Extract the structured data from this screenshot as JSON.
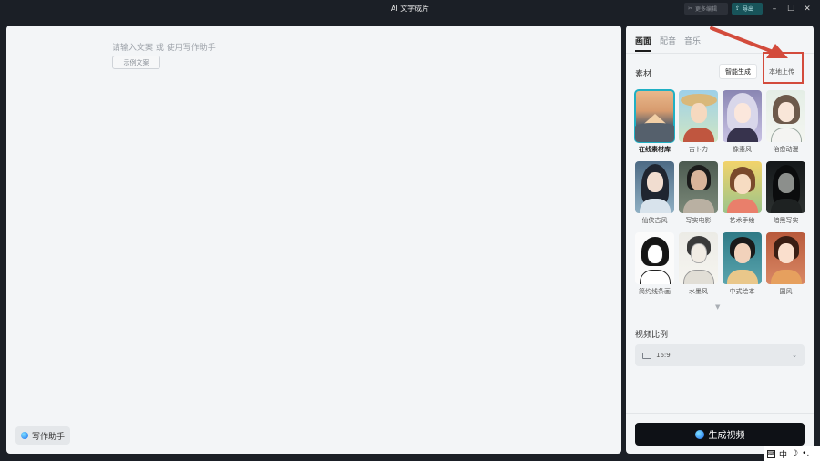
{
  "window": {
    "title": "AI 文字成片",
    "more_edit_label": "更多编辑",
    "export_label": "导出",
    "controls": [
      "minimize-icon",
      "maximize-icon",
      "close-icon"
    ]
  },
  "editor": {
    "placeholder": "请输入文案 或 使用写作助手",
    "example_button": "示例文案",
    "assistant_button": "写作助手"
  },
  "panel": {
    "tabs": [
      {
        "label": "画面",
        "active": true
      },
      {
        "label": "配音",
        "active": false
      },
      {
        "label": "音乐",
        "active": false
      }
    ],
    "material_label": "素材",
    "mode_smart": "智能生成",
    "mode_local": "本地上传",
    "styles": [
      {
        "label": "在线素材库",
        "selected": true,
        "icon": "mountain-landscape"
      },
      {
        "label": "吉卜力",
        "selected": false,
        "icon": "anime-girl-straw-hat"
      },
      {
        "label": "像素风",
        "selected": false,
        "icon": "anime-girl-silver-hair"
      },
      {
        "label": "治愈动漫",
        "selected": false,
        "icon": "sketch-girl"
      },
      {
        "label": "仙侠古风",
        "selected": false,
        "icon": "ancient-woman"
      },
      {
        "label": "写实电影",
        "selected": false,
        "icon": "realistic-woman"
      },
      {
        "label": "艺术手绘",
        "selected": false,
        "icon": "painted-girl-flowers"
      },
      {
        "label": "暗黑写实",
        "selected": false,
        "icon": "dark-woman"
      },
      {
        "label": "简约线条画",
        "selected": false,
        "icon": "line-art-girl"
      },
      {
        "label": "水墨风",
        "selected": false,
        "icon": "ink-woman"
      },
      {
        "label": "中式绘本",
        "selected": false,
        "icon": "chinese-girl-fan"
      },
      {
        "label": "国风",
        "selected": false,
        "icon": "chinese-doll"
      }
    ],
    "ratio_label": "视频比例",
    "ratio_value": "16:9",
    "generate_button": "生成视频"
  },
  "tray": {
    "ime": "中"
  },
  "colors": {
    "accent": "#1fb0c4",
    "annotation": "#d34b3c",
    "generate_bg": "#0e1116"
  }
}
